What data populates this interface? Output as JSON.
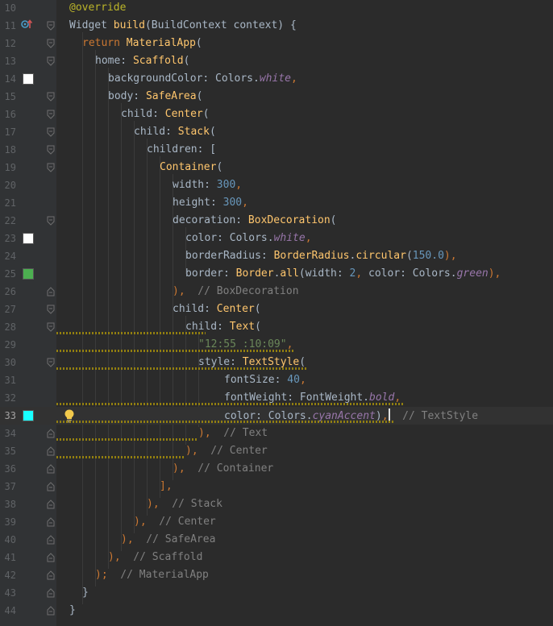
{
  "editor": {
    "current_line": 33,
    "lines": [
      {
        "num": "10",
        "fold": "none",
        "swatch": null,
        "indent": 0,
        "tokens": [
          {
            "t": "@override",
            "c": "an"
          }
        ]
      },
      {
        "num": "11",
        "fold": "open",
        "swatch": null,
        "overrideIcon": true,
        "indent": 0,
        "tokens": [
          {
            "t": "Widget ",
            "c": "pl"
          },
          {
            "t": "build",
            "c": "fn"
          },
          {
            "t": "(BuildContext context) {",
            "c": "pl"
          }
        ]
      },
      {
        "num": "12",
        "fold": "open",
        "swatch": null,
        "indent": 1,
        "tokens": [
          {
            "t": "return ",
            "c": "kw"
          },
          {
            "t": "MaterialApp",
            "c": "fn"
          },
          {
            "t": "(",
            "c": "pl"
          }
        ]
      },
      {
        "num": "13",
        "fold": "open",
        "swatch": null,
        "indent": 2,
        "tokens": [
          {
            "t": "home: ",
            "c": "pl"
          },
          {
            "t": "Scaffold",
            "c": "fn"
          },
          {
            "t": "(",
            "c": "pl"
          }
        ]
      },
      {
        "num": "14",
        "fold": "none",
        "swatch": "#ffffff",
        "indent": 3,
        "tokens": [
          {
            "t": "backgroundColor: Colors.",
            "c": "pl"
          },
          {
            "t": "white",
            "c": "it"
          },
          {
            "t": ",",
            "c": "kw"
          }
        ]
      },
      {
        "num": "15",
        "fold": "open",
        "swatch": null,
        "indent": 3,
        "tokens": [
          {
            "t": "body: ",
            "c": "pl"
          },
          {
            "t": "SafeArea",
            "c": "fn"
          },
          {
            "t": "(",
            "c": "pl"
          }
        ]
      },
      {
        "num": "16",
        "fold": "open",
        "swatch": null,
        "indent": 4,
        "tokens": [
          {
            "t": "child: ",
            "c": "pl"
          },
          {
            "t": "Center",
            "c": "fn"
          },
          {
            "t": "(",
            "c": "pl"
          }
        ]
      },
      {
        "num": "17",
        "fold": "open",
        "swatch": null,
        "indent": 5,
        "tokens": [
          {
            "t": "child: ",
            "c": "pl"
          },
          {
            "t": "Stack",
            "c": "fn"
          },
          {
            "t": "(",
            "c": "pl"
          }
        ]
      },
      {
        "num": "18",
        "fold": "open",
        "swatch": null,
        "indent": 6,
        "tokens": [
          {
            "t": "children: [",
            "c": "pl"
          }
        ]
      },
      {
        "num": "19",
        "fold": "open",
        "swatch": null,
        "indent": 7,
        "tokens": [
          {
            "t": "Container",
            "c": "fn"
          },
          {
            "t": "(",
            "c": "pl"
          }
        ]
      },
      {
        "num": "20",
        "fold": "none",
        "swatch": null,
        "indent": 8,
        "tokens": [
          {
            "t": "width: ",
            "c": "pl"
          },
          {
            "t": "300",
            "c": "num"
          },
          {
            "t": ",",
            "c": "kw"
          }
        ]
      },
      {
        "num": "21",
        "fold": "none",
        "swatch": null,
        "indent": 8,
        "tokens": [
          {
            "t": "height: ",
            "c": "pl"
          },
          {
            "t": "300",
            "c": "num"
          },
          {
            "t": ",",
            "c": "kw"
          }
        ]
      },
      {
        "num": "22",
        "fold": "open",
        "swatch": null,
        "indent": 8,
        "tokens": [
          {
            "t": "decoration: ",
            "c": "pl"
          },
          {
            "t": "BoxDecoration",
            "c": "fn"
          },
          {
            "t": "(",
            "c": "pl"
          }
        ]
      },
      {
        "num": "23",
        "fold": "none",
        "swatch": "#ffffff",
        "indent": 9,
        "tokens": [
          {
            "t": "color: Colors.",
            "c": "pl"
          },
          {
            "t": "white",
            "c": "it"
          },
          {
            "t": ",",
            "c": "kw"
          }
        ]
      },
      {
        "num": "24",
        "fold": "none",
        "swatch": null,
        "indent": 9,
        "tokens": [
          {
            "t": "borderRadius: ",
            "c": "pl"
          },
          {
            "t": "BorderRadius",
            "c": "fn"
          },
          {
            "t": ".",
            "c": "pl"
          },
          {
            "t": "circular",
            "c": "fn"
          },
          {
            "t": "(",
            "c": "pl"
          },
          {
            "t": "150.0",
            "c": "num"
          },
          {
            "t": "),",
            "c": "kw"
          }
        ]
      },
      {
        "num": "25",
        "fold": "none",
        "swatch": "#4caf50",
        "indent": 9,
        "tokens": [
          {
            "t": "border: ",
            "c": "pl"
          },
          {
            "t": "Border",
            "c": "fn"
          },
          {
            "t": ".",
            "c": "pl"
          },
          {
            "t": "all",
            "c": "fn"
          },
          {
            "t": "(width: ",
            "c": "pl"
          },
          {
            "t": "2",
            "c": "num"
          },
          {
            "t": ", ",
            "c": "kw"
          },
          {
            "t": "color: Colors.",
            "c": "pl"
          },
          {
            "t": "green",
            "c": "it"
          },
          {
            "t": "),",
            "c": "kw"
          }
        ]
      },
      {
        "num": "26",
        "fold": "close",
        "swatch": null,
        "indent": 8,
        "tokens": [
          {
            "t": "),",
            "c": "kw"
          },
          {
            "t": "  // BoxDecoration",
            "c": "cm"
          }
        ]
      },
      {
        "num": "27",
        "fold": "open",
        "swatch": null,
        "indent": 8,
        "tokens": [
          {
            "t": "child: ",
            "c": "pl"
          },
          {
            "t": "Center",
            "c": "fn"
          },
          {
            "t": "(",
            "c": "pl"
          }
        ]
      },
      {
        "num": "28",
        "fold": "open",
        "swatch": null,
        "indent": 9,
        "tokens": [
          {
            "t": "child: ",
            "c": "pl"
          },
          {
            "t": "Text",
            "c": "fn"
          },
          {
            "t": "(",
            "c": "pl"
          }
        ]
      },
      {
        "num": "29",
        "fold": "none",
        "swatch": null,
        "indent": 10,
        "tokens": [
          {
            "t": "\"12:55 :10:09\"",
            "c": "str"
          },
          {
            "t": ",",
            "c": "kw"
          }
        ]
      },
      {
        "num": "30",
        "fold": "open",
        "swatch": null,
        "indent": 10,
        "tokens": [
          {
            "t": "style: ",
            "c": "pl"
          },
          {
            "t": "TextStyle",
            "c": "fn"
          },
          {
            "t": "(",
            "c": "pl"
          }
        ]
      },
      {
        "num": "31",
        "fold": "none",
        "swatch": null,
        "indent": 12,
        "tokens": [
          {
            "t": "fontSize: ",
            "c": "pl"
          },
          {
            "t": "40",
            "c": "num"
          },
          {
            "t": ",",
            "c": "kw"
          }
        ]
      },
      {
        "num": "32",
        "fold": "none",
        "swatch": null,
        "indent": 12,
        "tokens": [
          {
            "t": "fontWeight: FontWeight.",
            "c": "pl"
          },
          {
            "t": "bold",
            "c": "it"
          },
          {
            "t": ",",
            "c": "kw"
          }
        ]
      },
      {
        "num": "33",
        "fold": "none",
        "swatch": "#18ffff",
        "bulb": true,
        "caret": true,
        "indent": 12,
        "tokens": [
          {
            "t": "color: Colors.",
            "c": "pl"
          },
          {
            "t": "cyanAccent",
            "c": "it"
          },
          {
            "t": ")",
            "c": "pl"
          },
          {
            "t": ",",
            "c": "kw"
          },
          {
            "t": "CARET",
            "c": "caret"
          },
          {
            "t": "  // TextStyle",
            "c": "cm"
          }
        ]
      },
      {
        "num": "34",
        "fold": "close",
        "swatch": null,
        "indent": 10,
        "tokens": [
          {
            "t": "),",
            "c": "kw"
          },
          {
            "t": "  // Text",
            "c": "cm"
          }
        ]
      },
      {
        "num": "35",
        "fold": "close",
        "swatch": null,
        "indent": 9,
        "tokens": [
          {
            "t": "),",
            "c": "kw"
          },
          {
            "t": "  // Center",
            "c": "cm"
          }
        ]
      },
      {
        "num": "36",
        "fold": "close",
        "swatch": null,
        "indent": 8,
        "tokens": [
          {
            "t": "),",
            "c": "kw"
          },
          {
            "t": "  // Container",
            "c": "cm"
          }
        ]
      },
      {
        "num": "37",
        "fold": "close",
        "swatch": null,
        "indent": 7,
        "tokens": [
          {
            "t": "],",
            "c": "kw"
          }
        ]
      },
      {
        "num": "38",
        "fold": "close",
        "swatch": null,
        "indent": 6,
        "tokens": [
          {
            "t": "),",
            "c": "kw"
          },
          {
            "t": "  // Stack",
            "c": "cm"
          }
        ]
      },
      {
        "num": "39",
        "fold": "close",
        "swatch": null,
        "indent": 5,
        "tokens": [
          {
            "t": "),",
            "c": "kw"
          },
          {
            "t": "  // Center",
            "c": "cm"
          }
        ]
      },
      {
        "num": "40",
        "fold": "close",
        "swatch": null,
        "indent": 4,
        "tokens": [
          {
            "t": "),",
            "c": "kw"
          },
          {
            "t": "  // SafeArea",
            "c": "cm"
          }
        ]
      },
      {
        "num": "41",
        "fold": "close",
        "swatch": null,
        "indent": 3,
        "tokens": [
          {
            "t": "),",
            "c": "kw"
          },
          {
            "t": "  // Scaffold",
            "c": "cm"
          }
        ]
      },
      {
        "num": "42",
        "fold": "close",
        "swatch": null,
        "indent": 2,
        "tokens": [
          {
            "t": ");",
            "c": "kw"
          },
          {
            "t": "  // MaterialApp",
            "c": "cm"
          }
        ]
      },
      {
        "num": "43",
        "fold": "close",
        "swatch": null,
        "indent": 1,
        "tokens": [
          {
            "t": "}",
            "c": "pl"
          }
        ]
      },
      {
        "num": "44",
        "fold": "close",
        "swatch": null,
        "indent": 0,
        "tokens": [
          {
            "t": "}",
            "c": "pl"
          }
        ]
      }
    ],
    "colors": {
      "background": "#2b2b2b",
      "gutter": "#313335",
      "keyword": "#cc7832",
      "function": "#ffc66d",
      "number": "#6897bb",
      "string": "#6a8759",
      "comment": "#808080",
      "constant": "#9876aa",
      "annotation": "#bbb529",
      "warning_underline": "#9e880d"
    },
    "icons": {
      "override_marker": "override-gutter-icon",
      "fold_marker": "fold-icon",
      "intention": "lightbulb-icon"
    }
  }
}
